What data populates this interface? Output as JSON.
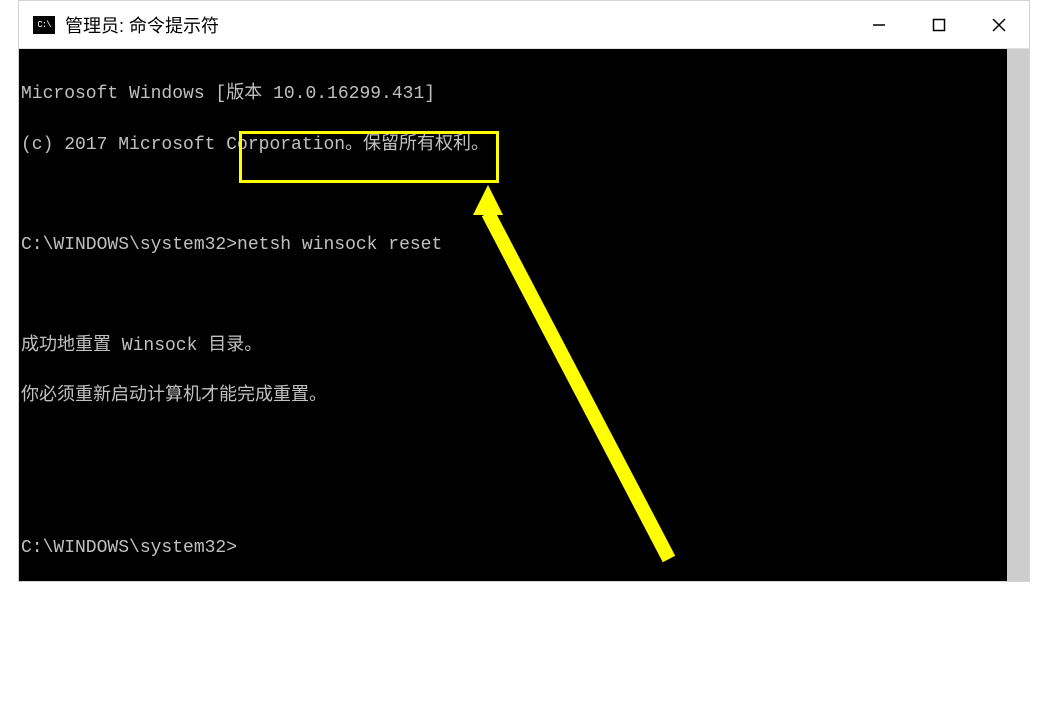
{
  "window": {
    "title": "管理员: 命令提示符"
  },
  "terminal": {
    "line1": "Microsoft Windows [版本 10.0.16299.431]",
    "line2": "(c) 2017 Microsoft Corporation。保留所有权利。",
    "line3_prompt": "C:\\WINDOWS\\system32>",
    "line3_command": "netsh winsock reset",
    "line4": "成功地重置 Winsock 目录。",
    "line5": "你必须重新启动计算机才能完成重置。",
    "line6": "C:\\WINDOWS\\system32>"
  },
  "colors": {
    "highlight": "#ffff00",
    "terminal_bg": "#000000",
    "terminal_fg": "#c0c0c0"
  }
}
